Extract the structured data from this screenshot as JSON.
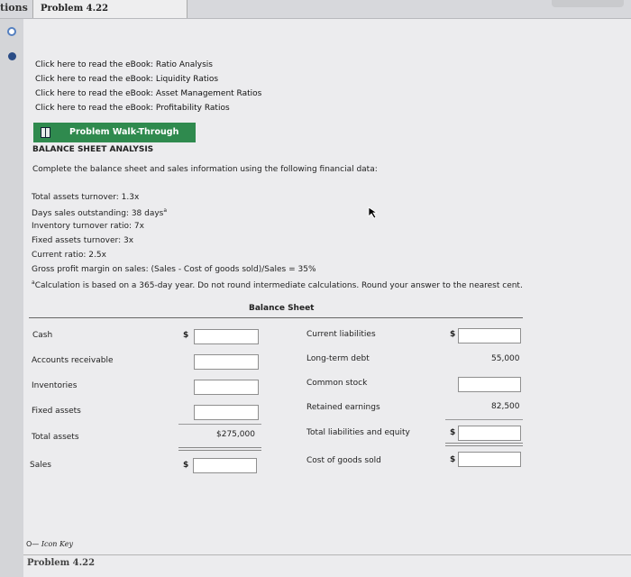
{
  "tabs": {
    "questions": "tions",
    "problem": "Problem 4.22"
  },
  "links": [
    "Click here to read the eBook: Ratio Analysis",
    "Click here to read the eBook: Liquidity Ratios",
    "Click here to read the eBook: Asset Management Ratios",
    "Click here to read the eBook: Profitability Ratios"
  ],
  "walkthrough_label": "Problem Walk-Through",
  "heading": "BALANCE SHEET ANALYSIS",
  "instruction": "Complete the balance sheet and sales information using the following financial data:",
  "data_lines": [
    "Total assets turnover: 1.3x",
    "Days sales outstanding: 38 days",
    "Inventory turnover ratio: 7x",
    "Fixed assets turnover: 3x",
    "Current ratio: 2.5x",
    "Gross profit margin on sales: (Sales - Cost of goods sold)/Sales = 35%"
  ],
  "footnote_marker": "a",
  "footnote": "Calculation is based on a 365-day year. Do not round intermediate calculations. Round your answer to the nearest cent.",
  "table_title": "Balance Sheet",
  "left_rows": {
    "cash": "Cash",
    "ar": "Accounts receivable",
    "inv": "Inventories",
    "fixed": "Fixed assets",
    "total": "Total assets",
    "sales": "Sales"
  },
  "right_rows": {
    "cl": "Current liabilities",
    "ltd": "Long-term debt",
    "cs": "Common stock",
    "re": "Retained earnings",
    "tle": "Total liabilities and equity",
    "cogs": "Cost of goods sold"
  },
  "values": {
    "total_assets": "$275,000",
    "long_term_debt": "55,000",
    "retained_earnings": "82,500"
  },
  "currency": "$",
  "icon_key": "Icon Key",
  "bottom_label": "Problem 4.22"
}
